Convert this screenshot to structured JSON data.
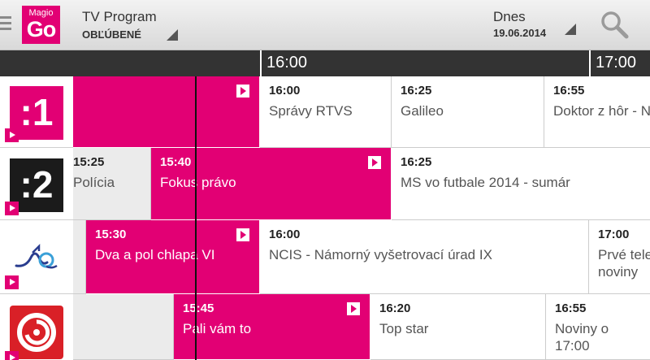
{
  "app": {
    "logo_top": "Magio",
    "logo_bottom": "Go",
    "title": "TV Program",
    "filter": "OBĽÚBENÉ",
    "date_label": "Dnes",
    "date_value": "19.06.2014"
  },
  "timeline": [
    "16:00",
    "17:00"
  ],
  "channels": [
    {
      "name": ":1",
      "programs": [
        {
          "time": "",
          "title": "",
          "state": "now"
        },
        {
          "time": "16:00",
          "title": "Správy RTVS",
          "state": "future"
        },
        {
          "time": "16:25",
          "title": "Galileo",
          "state": "future"
        },
        {
          "time": "16:55",
          "title": "Doktor z hôr - N",
          "state": "future"
        }
      ]
    },
    {
      "name": ":2",
      "programs": [
        {
          "time": "15:25",
          "title": "Polícia",
          "state": "past"
        },
        {
          "time": "15:40",
          "title": "Fokus právo",
          "state": "now"
        },
        {
          "time": "16:25",
          "title": "MS vo futbale 2014 - sumár",
          "state": "future"
        }
      ]
    },
    {
      "name": "JOJ Plus",
      "programs": [
        {
          "time": "",
          "title": "",
          "state": "past"
        },
        {
          "time": "15:30",
          "title": "Dva a pol chlapa VI",
          "state": "now"
        },
        {
          "time": "16:00",
          "title": "NCIS - Námorný vyšetrovací úrad IX",
          "state": "future"
        },
        {
          "time": "17:00",
          "title": "Prvé tele noviny",
          "state": "future"
        }
      ]
    },
    {
      "name": "Markíza",
      "programs": [
        {
          "time": "",
          "title": "",
          "state": "past"
        },
        {
          "time": "15:45",
          "title": "Pali vám to",
          "state": "now"
        },
        {
          "time": "16:20",
          "title": "Top star",
          "state": "future"
        },
        {
          "time": "16:55",
          "title": "Noviny o 17:00",
          "state": "future"
        }
      ]
    }
  ],
  "colors": {
    "accent": "#e20074",
    "timeline_bg": "#333333",
    "past_bg": "#ebebeb"
  }
}
